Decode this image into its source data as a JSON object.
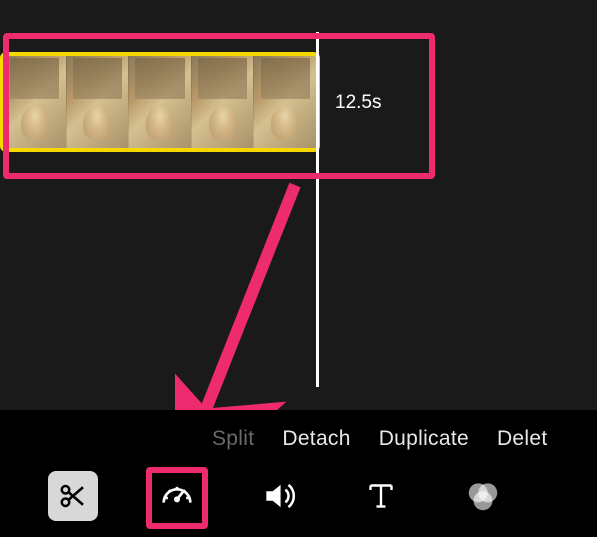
{
  "timeline": {
    "clip": {
      "duration_label": "12.5s",
      "selected": true,
      "thumbnail_count": 5
    },
    "playhead_visible": true
  },
  "actions": {
    "split": "Split",
    "detach": "Detach",
    "duplicate": "Duplicate",
    "delete": "Delet"
  },
  "tools": {
    "scissors": "scissors-icon",
    "speed": "speedometer-icon",
    "volume": "volume-icon",
    "text": "text-icon",
    "filters": "filters-icon"
  },
  "annotations": {
    "highlight_color": "#ee2b6e",
    "clip_highlighted": true,
    "speed_tool_highlighted": true,
    "arrow_from_clip_to_speed": true
  }
}
